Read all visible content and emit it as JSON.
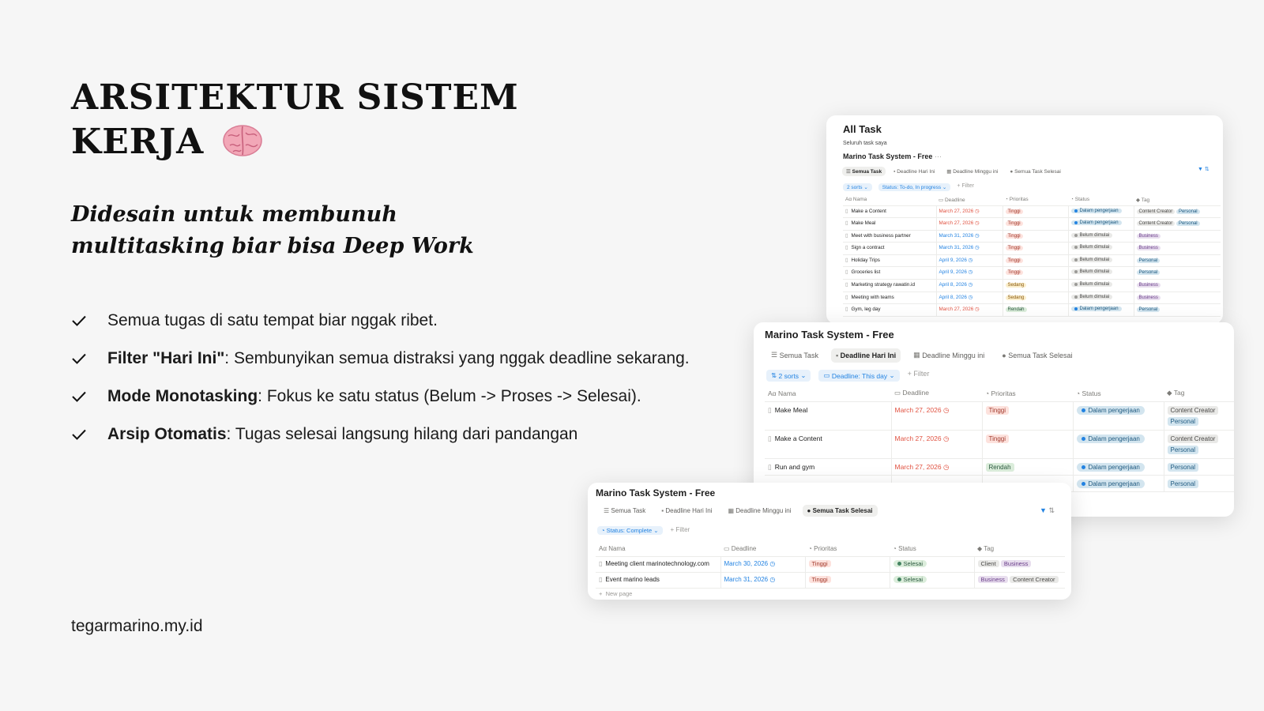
{
  "hero": {
    "title": "ARSITEKTUR SISTEM KERJA",
    "title_emoji": "brain-emoji",
    "subtitle_line1": "Didesain untuk membunuh",
    "subtitle_line2": "multitasking biar bisa Deep Work"
  },
  "features": [
    {
      "bold": "",
      "text": "Semua tugas di satu tempat biar nggak ribet."
    },
    {
      "bold": "Filter \"Hari Ini\"",
      "text": ": Sembunyikan semua distraksi yang nggak deadline sekarang."
    },
    {
      "bold": "Mode Monotasking",
      "text": ": Fokus ke satu status (Belum -> Proses -> Selesai)."
    },
    {
      "bold": "Arsip Otomatis",
      "text": ": Tugas selesai langsung hilang dari pandangan"
    }
  ],
  "footer": "tegarmarino.my.id",
  "colors": {
    "accent": "#2383e2",
    "red": "#e15241",
    "bg": "#f6f6f6"
  },
  "cardA": {
    "title": "All Task",
    "description": "Seluruh task saya",
    "database": "Marino Task System - Free",
    "database_more": "···",
    "tabs": [
      "Semua Task",
      "Deadline Hari Ini",
      "Deadline Minggu ini",
      "Semua Task Selesai"
    ],
    "sorts": "2 sorts",
    "status_filter": "Status: To-do, In progress",
    "filter": "+ Filter",
    "columns": [
      "Nama",
      "Deadline",
      "Prioritas",
      "Status",
      "Tag"
    ],
    "rows": [
      {
        "name": "Make a Content",
        "deadline": "March 27, 2026",
        "dl": "red",
        "prio": "Tinggi",
        "status": "Dalam pengerjaan",
        "tags": [
          "Content Creator",
          "Personal"
        ]
      },
      {
        "name": "Make Meal",
        "deadline": "March 27, 2026",
        "dl": "red",
        "prio": "Tinggi",
        "status": "Dalam pengerjaan",
        "tags": [
          "Content Creator",
          "Personal"
        ]
      },
      {
        "name": "Meet with business partner",
        "deadline": "March 31, 2026",
        "dl": "blue",
        "prio": "Tinggi",
        "status": "Belum dimulai",
        "tags": [
          "Business"
        ]
      },
      {
        "name": "Sign a contract",
        "deadline": "March 31, 2026",
        "dl": "blue",
        "prio": "Tinggi",
        "status": "Belum dimulai",
        "tags": [
          "Business"
        ]
      },
      {
        "name": "Holiday Trips",
        "deadline": "April 9, 2026",
        "dl": "blue",
        "prio": "Tinggi",
        "status": "Belum dimulai",
        "tags": [
          "Personal"
        ]
      },
      {
        "name": "Groceries list",
        "deadline": "April 9, 2026",
        "dl": "blue",
        "prio": "Tinggi",
        "status": "Belum dimulai",
        "tags": [
          "Personal"
        ]
      },
      {
        "name": "Marketing strategy rawatin.id",
        "deadline": "April 8, 2026",
        "dl": "blue",
        "prio": "Sedang",
        "status": "Belum dimulai",
        "tags": [
          "Business"
        ]
      },
      {
        "name": "Meeting with teams",
        "deadline": "April 8, 2026",
        "dl": "blue",
        "prio": "Sedang",
        "status": "Belum dimulai",
        "tags": [
          "Business"
        ]
      },
      {
        "name": "Gym, leg day",
        "deadline": "March 27, 2026",
        "dl": "red",
        "prio": "Rendah",
        "status": "Dalam pengerjaan",
        "tags": [
          "Personal"
        ]
      }
    ]
  },
  "cardB": {
    "database": "Marino Task System - Free",
    "tabs": [
      "Semua Task",
      "Deadline Hari Ini",
      "Deadline Minggu ini",
      "Semua Task Selesai"
    ],
    "sorts": "2 sorts",
    "deadline_filter": "Deadline: This day",
    "filter": "+ Filter",
    "columns": [
      "Nama",
      "Deadline",
      "Prioritas",
      "Status",
      "Tag"
    ],
    "rows": [
      {
        "name": "Make Meal",
        "deadline": "March 27, 2026",
        "prio": "Tinggi",
        "status": "Dalam pengerjaan",
        "tags": [
          "Content Creator",
          "Personal"
        ]
      },
      {
        "name": "Make a Content",
        "deadline": "March 27, 2026",
        "prio": "Tinggi",
        "status": "Dalam pengerjaan",
        "tags": [
          "Content Creator",
          "Personal"
        ]
      },
      {
        "name": "Run and gym",
        "deadline": "March 27, 2026",
        "prio": "Rendah",
        "status": "Dalam pengerjaan",
        "tags": [
          "Personal"
        ]
      },
      {
        "name": "",
        "deadline": "",
        "prio": "",
        "status": "Dalam pengerjaan",
        "tags": [
          "Personal"
        ]
      }
    ]
  },
  "cardC": {
    "database": "Marino Task System - Free",
    "tabs": [
      "Semua Task",
      "Deadline Hari Ini",
      "Deadline Minggu ini",
      "Semua Task Selesai"
    ],
    "status_filter": "Status: Complete",
    "filter": "+ Filter",
    "columns": [
      "Nama",
      "Deadline",
      "Prioritas",
      "Status",
      "Tag"
    ],
    "rows": [
      {
        "name": "Meeting client marinotechnology.com",
        "deadline": "March 30, 2026",
        "prio": "Tinggi",
        "status": "Selesai",
        "tags": [
          "Client",
          "Business"
        ]
      },
      {
        "name": "Event marino leads",
        "deadline": "March 31, 2026",
        "prio": "Tinggi",
        "status": "Selesai",
        "tags": [
          "Business",
          "Content Creator"
        ]
      }
    ],
    "new_page": "New page"
  }
}
